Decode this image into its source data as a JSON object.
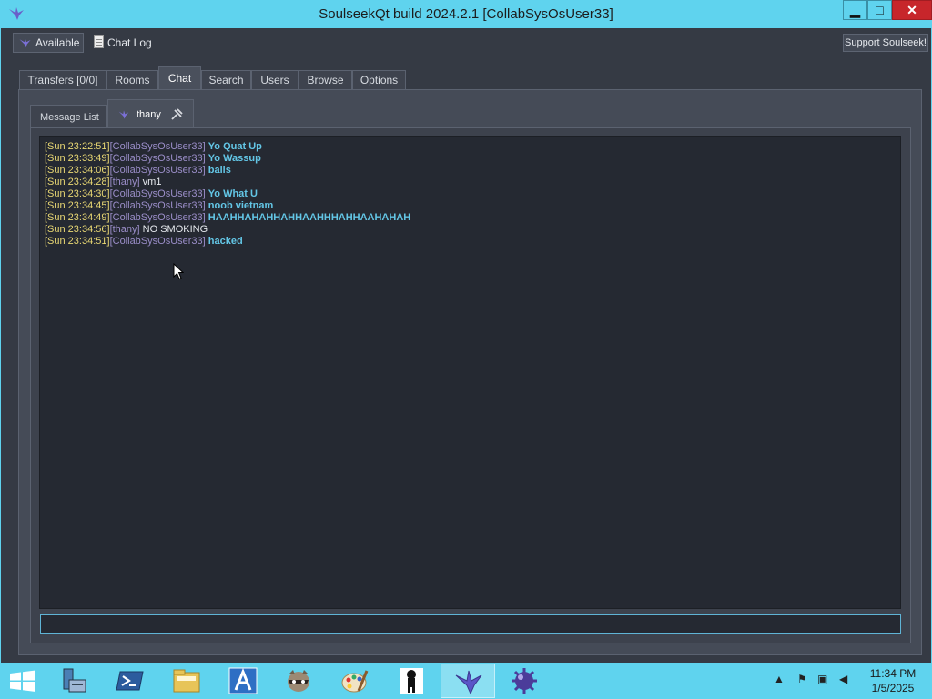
{
  "window": {
    "title": "SoulseekQt build 2024.2.1 [CollabSysOsUser33]",
    "controls": {
      "minimize": "▁",
      "maximize": "□",
      "close": "✕"
    }
  },
  "toolbar": {
    "status_label": "Available",
    "chat_log_label": "Chat Log",
    "support_label": "Support Soulseek!"
  },
  "main_tabs": [
    {
      "label": "Transfers [0/0]",
      "active": false
    },
    {
      "label": "Rooms",
      "active": false
    },
    {
      "label": "Chat",
      "active": true
    },
    {
      "label": "Search",
      "active": false
    },
    {
      "label": "Users",
      "active": false
    },
    {
      "label": "Browse",
      "active": false
    },
    {
      "label": "Options",
      "active": false
    }
  ],
  "chat_tabs": [
    {
      "label": "Message List",
      "active": false
    },
    {
      "label": "thany",
      "active": true
    }
  ],
  "messages": [
    {
      "time": "[Sun 23:22:51]",
      "user": "[CollabSysOsUser33]",
      "text": "Yo Quat Up",
      "self": true
    },
    {
      "time": "[Sun 23:33:49]",
      "user": "[CollabSysOsUser33]",
      "text": "Yo Wassup",
      "self": true
    },
    {
      "time": "[Sun 23:34:06]",
      "user": "[CollabSysOsUser33]",
      "text": "balls",
      "self": true
    },
    {
      "time": "[Sun 23:34:28]",
      "user": "[thany]",
      "text": "vm1",
      "self": false
    },
    {
      "time": "[Sun 23:34:30]",
      "user": "[CollabSysOsUser33]",
      "text": "Yo What U",
      "self": true
    },
    {
      "time": "[Sun 23:34:45]",
      "user": "[CollabSysOsUser33]",
      "text": "noob vietnam",
      "self": true
    },
    {
      "time": "[Sun 23:34:49]",
      "user": "[CollabSysOsUser33]",
      "text": "HAAHHAHAHHAHHAAHHHAHHAAHAHAH",
      "self": true
    },
    {
      "time": "[Sun 23:34:56]",
      "user": "[thany]",
      "text": "NO SMOKING",
      "self": false
    },
    {
      "time": "[Sun 23:34:51]",
      "user": "[CollabSysOsUser33]",
      "text": "hacked",
      "self": true
    }
  ],
  "chat_input": {
    "value": ""
  },
  "taskbar": {
    "items": [
      "server-manager-icon",
      "powershell-icon",
      "file-explorer-icon",
      "app-a-icon",
      "raccoon-icon",
      "paint-icon",
      "figure-icon",
      "soulseek-icon",
      "mine-icon"
    ],
    "active_item": "soulseek-icon",
    "time": "11:34 PM",
    "date": "1/5/2025"
  },
  "colors": {
    "accent": "#5fd3ee",
    "close": "#c7262b",
    "timestamp": "#e8d773",
    "username": "#9b8ec9",
    "self_text": "#63c6e6"
  }
}
